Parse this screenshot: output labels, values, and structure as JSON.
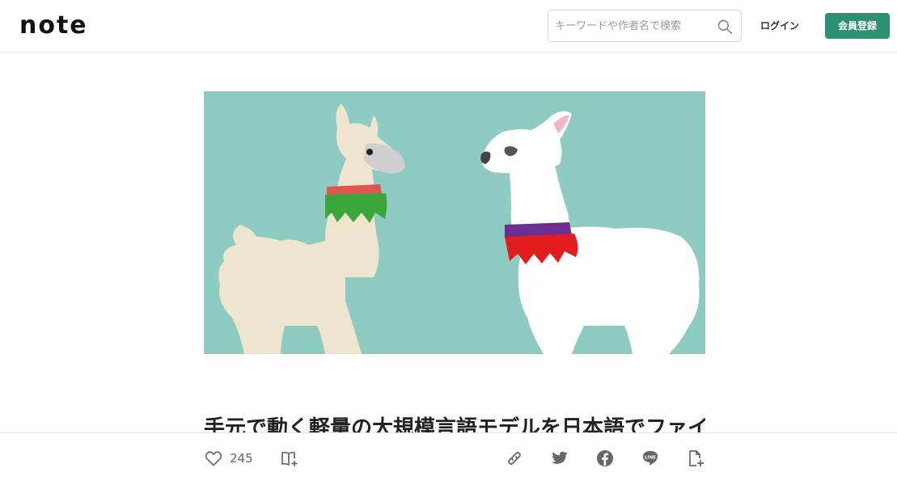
{
  "header": {
    "logo": "note",
    "search_placeholder": "キーワードや作者名で検索",
    "login_label": "ログイン",
    "signup_label": "会員登録"
  },
  "article": {
    "title": "手元で動く軽量の大規模言語モデルを日本語でファインチューニング",
    "like_count": "245"
  },
  "icons": {
    "search": "search-icon",
    "like": "heart-icon",
    "magazine": "magazine-add-icon",
    "link": "link-icon",
    "twitter": "twitter-icon",
    "facebook": "facebook-icon",
    "line": "line-icon",
    "embed": "embed-icon"
  },
  "colors": {
    "accent": "#2d8f73",
    "hero_bg": "#8ecbc0"
  },
  "share": {
    "line_text": "LINE"
  }
}
